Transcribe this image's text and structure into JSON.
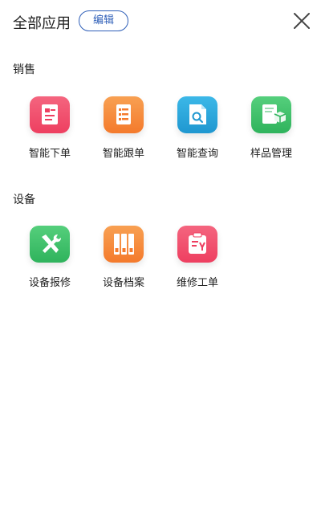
{
  "header": {
    "title": "全部应用",
    "edit_label": "编辑"
  },
  "sections": [
    {
      "title": "销售",
      "items": [
        {
          "label": "智能下单",
          "icon": "order-document-icon",
          "color": "#f04d6a"
        },
        {
          "label": "智能跟单",
          "icon": "tracking-list-icon",
          "color": "#f6893a"
        },
        {
          "label": "智能查询",
          "icon": "search-document-icon",
          "color": "#29a7dc"
        },
        {
          "label": "样品管理",
          "icon": "sample-box-icon",
          "color": "#3dbf6a"
        }
      ]
    },
    {
      "title": "设备",
      "items": [
        {
          "label": "设备报修",
          "icon": "repair-tools-icon",
          "color": "#3dbf6a"
        },
        {
          "label": "设备档案",
          "icon": "archive-binders-icon",
          "color": "#f6893a"
        },
        {
          "label": "维修工单",
          "icon": "work-order-clipboard-icon",
          "color": "#f04d6a"
        }
      ]
    }
  ]
}
